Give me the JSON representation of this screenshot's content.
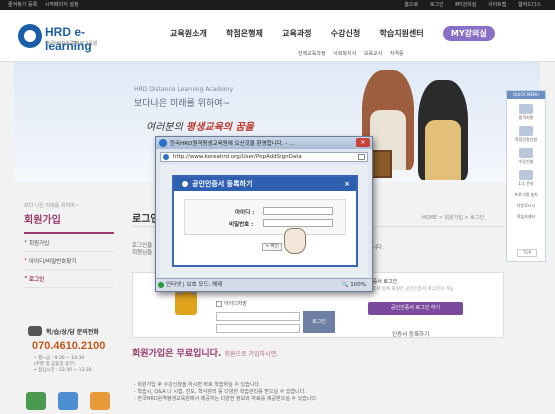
{
  "topbar": {
    "left_links": [
      "즐겨찾기 등록",
      "시작페이지 설정"
    ],
    "right_links": [
      "홈으로",
      "로그인",
      "MY강의실",
      "사이트맵",
      "웹하드다스"
    ]
  },
  "logo": {
    "name": "HRD e-learning",
    "tagline": "한국HRD원격평생교육원"
  },
  "nav": {
    "items": [
      "교육원소개",
      "학점은행제",
      "교육과정",
      "수강신청",
      "학습지원센터"
    ],
    "active": "MY강의실",
    "sub_items": [
      "전체교육과정",
      "사회복지사",
      "보육교사",
      "자격증"
    ]
  },
  "hero": {
    "english": "HRD Distance Learning Academy",
    "korean": "보다나은 미래를 위하여~",
    "script_plain": "여러분의",
    "script_accent": "평생교육의 꿈을"
  },
  "quick_menu": {
    "title": "QUICK MENU",
    "items": [
      "원격지원",
      "학점인정신청",
      "수강신청",
      "1:1 문의",
      "프로그램 설치",
      "다운로드시"
    ],
    "extra": "학습자센터",
    "top": "TOP"
  },
  "sidebar": {
    "subtitle": "보다 나은 미래를 위하여~",
    "title": "회원가입",
    "menu": [
      "회원가입",
      "아이디/비밀번호찾기",
      "로그인"
    ],
    "active_index": 2
  },
  "contact": {
    "label": "학/습/상/담 문의전화",
    "phone": "070.4610.2100",
    "hours_1": "• 평~금 : 9:30 ~ 18:30",
    "hours_2": "(주말 및 공휴일 휴무)",
    "hours_3": "• 점심시간 : 12:30 ~ 13:30"
  },
  "main": {
    "title": "로그인",
    "breadcrumb": "HOME > 회원가입 > 로그인",
    "desc_line1": "로그인을",
    "desc_line2": "회원님들",
    "desc_right": "니다.",
    "remember_label": "아이디저장",
    "login_button": "로그인",
    "cert_title": "인증서 로그인",
    "cert_sub": "인증서 등록 회원은 공인인증서 로그인이 가능",
    "cert_button": "공인인증서 로그인 하기",
    "cert_register": "인증서 등록하기"
  },
  "join": {
    "title": "회원가입은 무료입니다.",
    "subtitle": "회원으로 가입하시면,",
    "lines": [
      "- 회원가입 후 수강신청을 하시면 바로 학습하실 수 있습니다.",
      "- 학습시, Q&A 나 시험, 진도, 학사관리 등 다양한 학습관리를 받으실 수 있습니다.",
      "- 한국HRD원격평생교육원에서 제공하는 다양한 정보와 자료를 제공받으실 수 있습니다."
    ]
  },
  "popup": {
    "window_title": "한국HRD원격평생교육원에 오신것을 환영합니다. - ...",
    "url": "http://www.koreahrd.org/User/PopAddSignData",
    "dialog_title": "공인인증서 등록하기",
    "close_x": "×",
    "id_label": "아이디 :",
    "pw_label": "비밀번호 :",
    "confirm_button": "+ 확인",
    "status_text": "인터넷 | 보호 모드: 해제",
    "zoom": "100%"
  }
}
